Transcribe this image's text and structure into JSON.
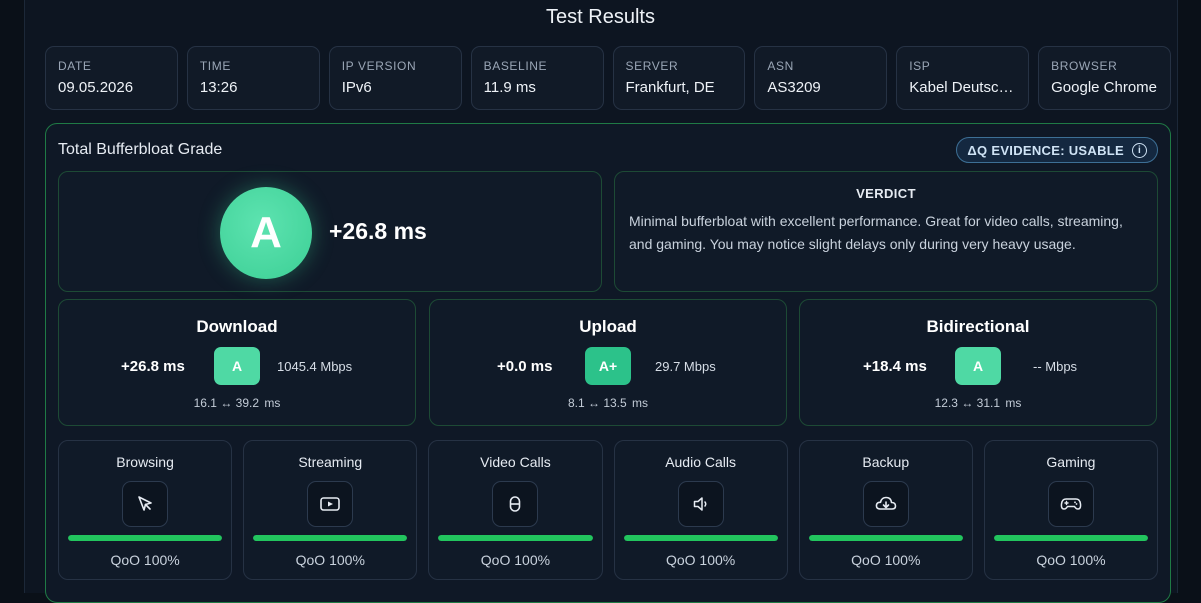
{
  "title": "Test Results",
  "info": [
    {
      "label": "DATE",
      "value": "09.05.2026"
    },
    {
      "label": "TIME",
      "value": "13:26"
    },
    {
      "label": "IP VERSION",
      "value": "IPv6"
    },
    {
      "label": "BASELINE",
      "value": "11.9 ms"
    },
    {
      "label": "SERVER",
      "value": "Frankfurt, DE"
    },
    {
      "label": "ASN",
      "value": "AS3209"
    },
    {
      "label": "ISP",
      "value": "Kabel Deutsch…"
    },
    {
      "label": "BROWSER",
      "value": "Google Chrome"
    }
  ],
  "grade": {
    "heading": "Total Bufferbloat Grade",
    "evidence": "ΔQ EVIDENCE: USABLE",
    "evidence_icon": "info-icon",
    "letter": "A",
    "delta": "+26.8 ms",
    "verdict_title": "VERDICT",
    "verdict_text": "Minimal bufferbloat with excellent performance. Great for video calls, streaming, and gaming. You may notice slight delays only during very heavy usage."
  },
  "directions": [
    {
      "title": "Download",
      "delta": "+26.8 ms",
      "grade": "A",
      "rate": "1045.4 Mbps",
      "range_low": "16.1",
      "arrow": "↔",
      "range_high": "39.2",
      "unit": "ms"
    },
    {
      "title": "Upload",
      "delta": "+0.0 ms",
      "grade": "A+",
      "rate": "29.7 Mbps",
      "range_low": "8.1",
      "arrow": "↔",
      "range_high": "13.5",
      "unit": "ms"
    },
    {
      "title": "Bidirectional",
      "delta": "+18.4 ms",
      "grade": "A",
      "rate": "-- Mbps",
      "range_low": "12.3",
      "arrow": "↔",
      "range_high": "31.1",
      "unit": "ms"
    }
  ],
  "qoe": [
    {
      "label": "Browsing",
      "icon": "cursor-icon",
      "score": "QoO 100%",
      "level": 1.0
    },
    {
      "label": "Streaming",
      "icon": "video-play-icon",
      "score": "QoO 100%",
      "level": 1.0
    },
    {
      "label": "Video Calls",
      "icon": "camera-icon",
      "score": "QoO 100%",
      "level": 1.0
    },
    {
      "label": "Audio Calls",
      "icon": "speaker-icon",
      "score": "QoO 100%",
      "level": 1.0
    },
    {
      "label": "Backup",
      "icon": "cloud-download-icon",
      "score": "QoO 100%",
      "level": 1.0
    },
    {
      "label": "Gaming",
      "icon": "gamepad-icon",
      "score": "QoO 100%",
      "level": 1.0
    }
  ],
  "colors": {
    "accent_green": "#22c55e",
    "grade_green": "#4fd9a4",
    "panel_border": "#1f7a45",
    "background": "#0d1521"
  }
}
